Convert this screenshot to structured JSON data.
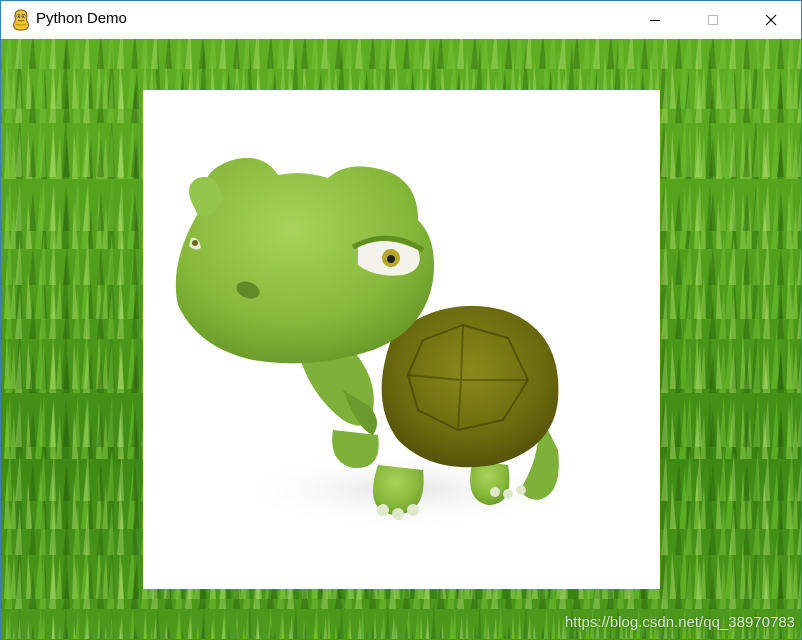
{
  "window": {
    "title": "Python Demo",
    "app_icon": "pygame-snake-icon",
    "controls": {
      "minimize_icon": "minimize-icon",
      "maximize_icon": "maximize-icon",
      "close_icon": "close-icon"
    },
    "border_color": "#3c7fb1"
  },
  "scene": {
    "background": "grass",
    "sprite": "cartoon-turtle",
    "sprite_background": "#ffffff"
  },
  "watermark": {
    "text": "https://blog.csdn.net/qq_38970783"
  }
}
